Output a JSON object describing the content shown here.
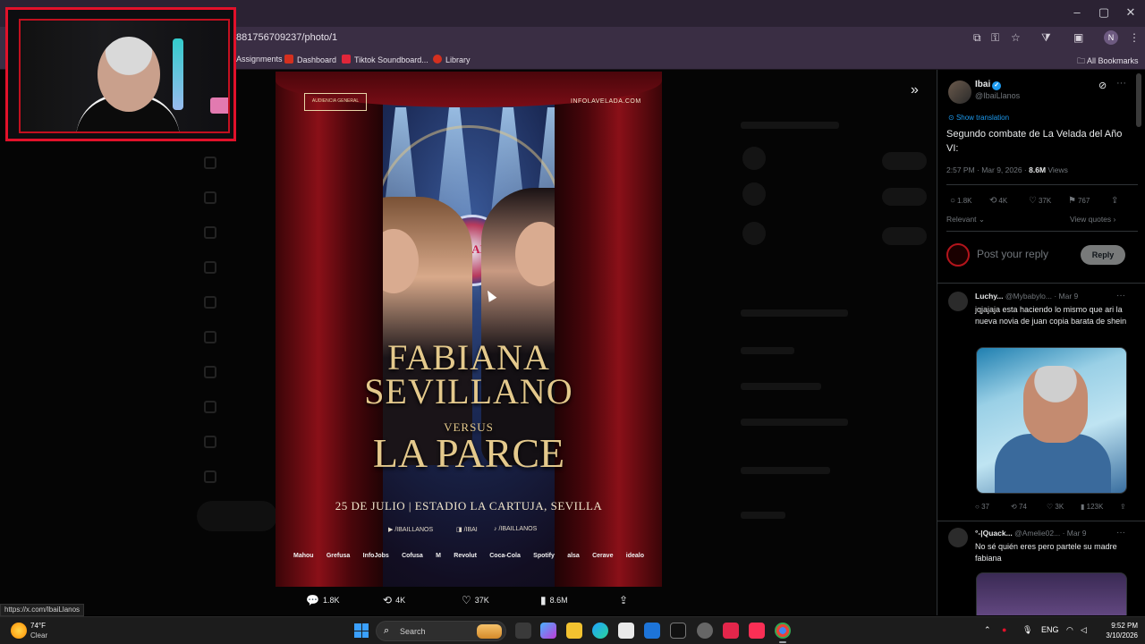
{
  "browser": {
    "url_fragment": "881756709237/photo/1",
    "bookmarks": [
      {
        "label": "Assignments",
        "color": "#e36b2c"
      },
      {
        "label": "Dashboard",
        "color": "#d4301f"
      },
      {
        "label": "Tiktok Soundboard...",
        "color": "#e0263a"
      },
      {
        "label": "Library",
        "color": "#d4301f"
      }
    ],
    "all_bookmarks": "All Bookmarks",
    "profile_initial": "N",
    "status_url": "https://x.com/IbaiLlanos"
  },
  "poster": {
    "badge_label": "AUDIENCIA GENERAL",
    "site": "INFOLAVELADA.COM",
    "event_logo": "VELADA",
    "name_line1": "FABIANA",
    "name_line2": "SEVILLANO",
    "versus": "VERSUS",
    "name_line3": "LA PARCE",
    "date_venue": "25 DE JULIO | ESTADIO LA CARTUJA, SEVILLA",
    "social": [
      "/IBAILLANOS",
      "/IBAI",
      "/IBAILLANOS"
    ],
    "sponsors": [
      "Mahou",
      "Grefusa",
      "InfoJobs",
      "Cofusa",
      "M",
      "Revolut",
      "Coca-Cola",
      "Spotify",
      "alsa",
      "Cerave",
      "idealo"
    ]
  },
  "media_actions": {
    "replies": "1.8K",
    "reposts": "4K",
    "likes": "37K",
    "views": "8.6M"
  },
  "post": {
    "name": "Ibai",
    "handle": "@IbaiLlanos",
    "show_translation": "Show translation",
    "text": "Segundo combate de La Velada del Año VI:",
    "time": "2:57 PM · Mar 9, 2026 · ",
    "views_count": "8.6M",
    "views_label": " Views",
    "stats": {
      "replies": "1.8K",
      "reposts": "4K",
      "likes": "37K",
      "bookmarks": "767"
    },
    "relevant": "Relevant",
    "view_quotes": "View quotes",
    "reply_placeholder": "Post your reply",
    "reply_button": "Reply"
  },
  "replies": [
    {
      "name": "Luchy...",
      "handle": "@Mybabylo...",
      "date": "· Mar 9",
      "text": "jqjajaja esta haciendo lo mismo que ari la nueva novia de juan copia barata de shein",
      "stats": {
        "replies": "37",
        "reposts": "74",
        "likes": "3K",
        "views": "123K"
      }
    },
    {
      "name": "°-|Quack...",
      "handle": "@Amelie02...",
      "date": "· Mar 9",
      "text": "No sé quién eres pero partele su madre fabiana"
    }
  ],
  "taskbar": {
    "temperature": "74°F",
    "weather": "Clear",
    "search": "Search",
    "lang": "ENG",
    "time": "9:52 PM",
    "date": "3/10/2026"
  },
  "colors": {
    "accent": "#1d9bf0",
    "cam_border": "#e1112a",
    "poster_gold": "#e4c98c"
  }
}
